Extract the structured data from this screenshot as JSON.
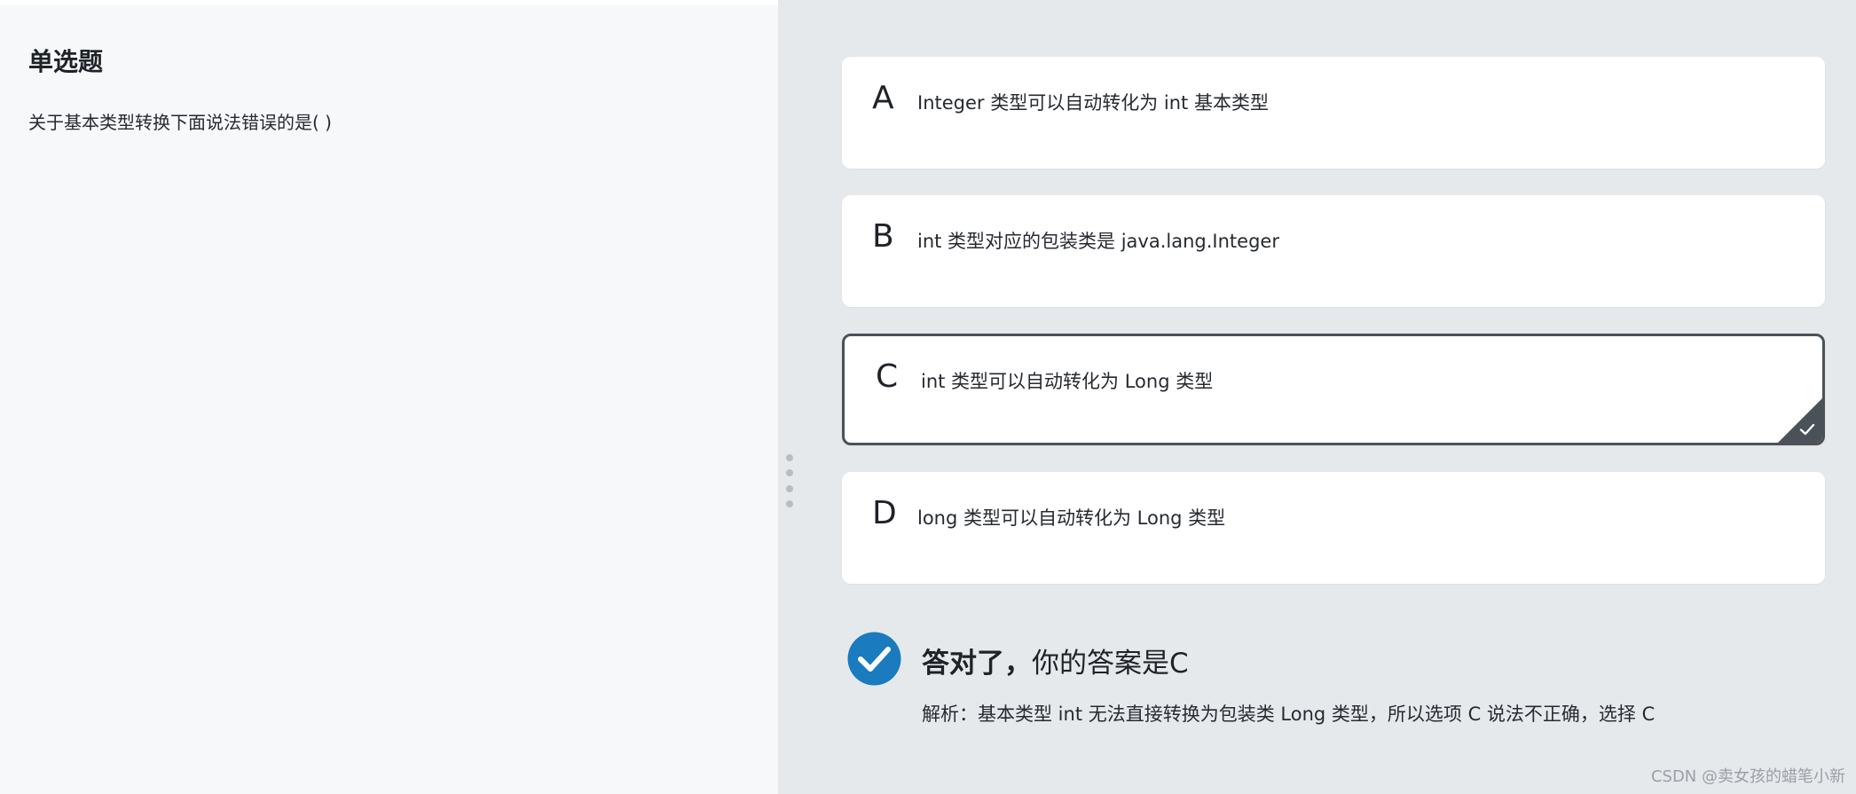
{
  "question": {
    "type_label": "单选题",
    "text": "关于基本类型转换下面说法错误的是( )"
  },
  "options": [
    {
      "letter": "A",
      "text": "Integer 类型可以自动转化为 int 基本类型",
      "selected": false
    },
    {
      "letter": "B",
      "text": "int 类型对应的包装类是 java.lang.Integer",
      "selected": false
    },
    {
      "letter": "C",
      "text": "int 类型可以自动转化为 Long 类型",
      "selected": true
    },
    {
      "letter": "D",
      "text": "long 类型可以自动转化为 Long 类型",
      "selected": false
    }
  ],
  "result": {
    "status_bold": "答对了，",
    "status_text": "你的答案是C",
    "explanation": "解析：基本类型 int 无法直接转换为包装类 Long 类型，所以选项 C 说法不正确，选择 C",
    "icon": "check-circle-icon"
  },
  "watermark": "CSDN @卖女孩的蜡笔小新",
  "colors": {
    "left_bg": "#f7f8fa",
    "right_bg": "#e6e9ec",
    "selected_border": "#4b5158",
    "correct_blue": "#1a7bbf"
  }
}
